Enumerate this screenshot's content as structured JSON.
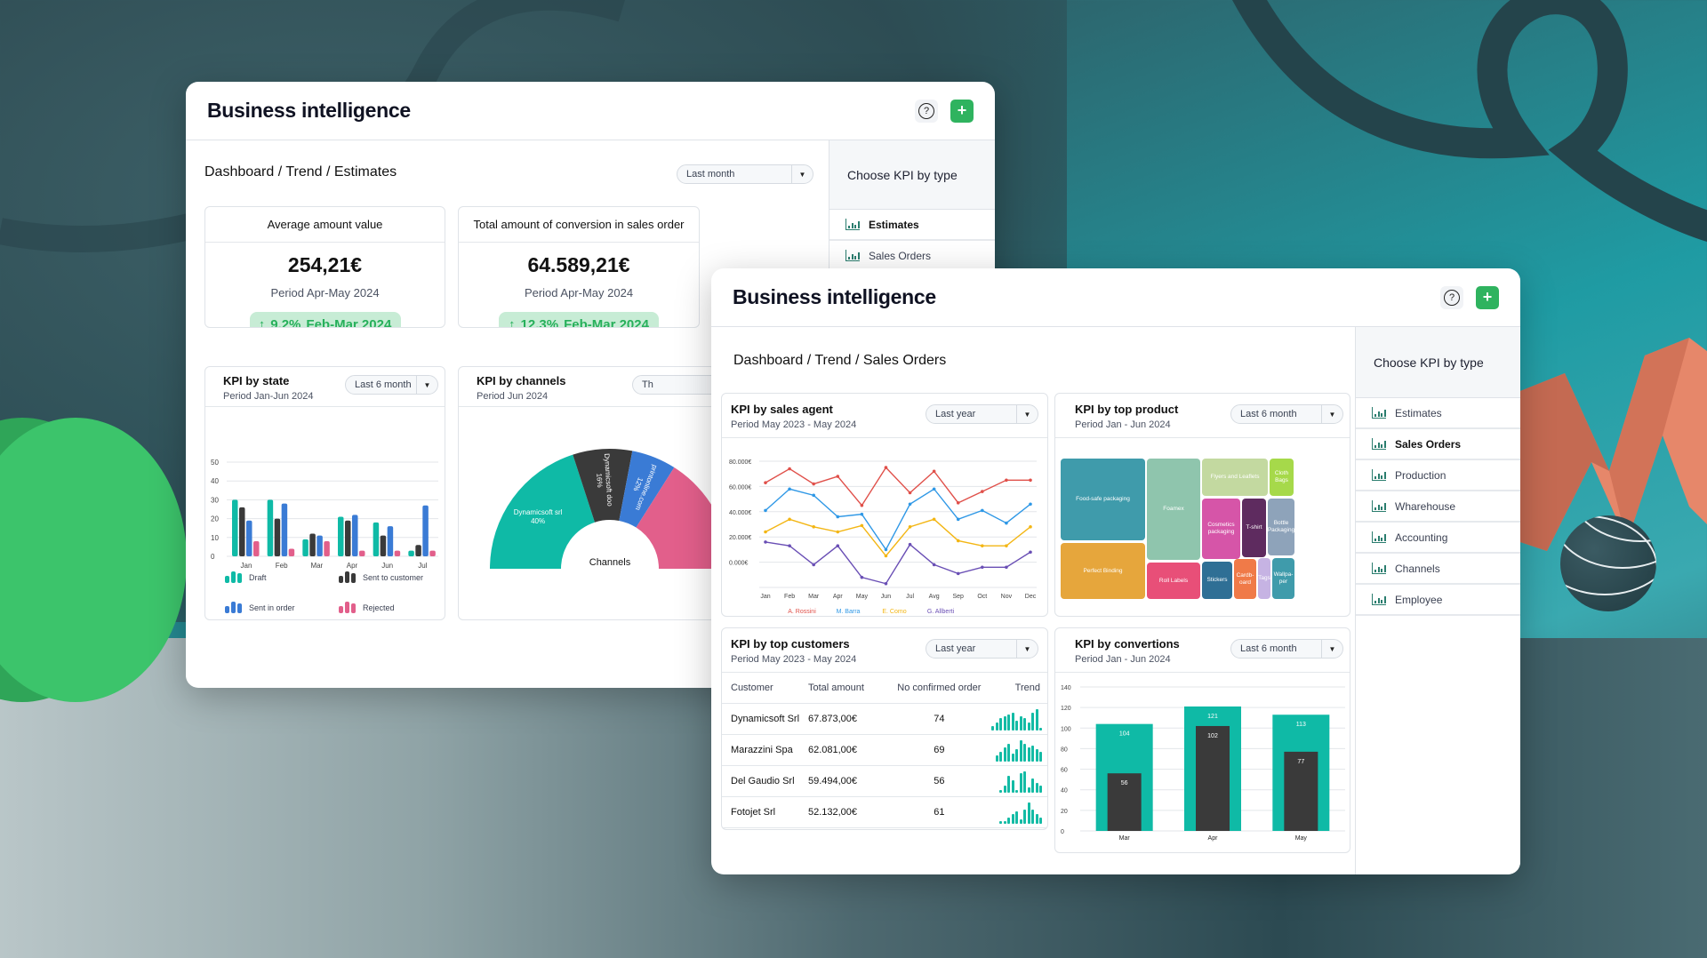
{
  "colors": {
    "teal": "#0fbaa6",
    "dark": "#3a3a3a",
    "blue": "#3a7bd5",
    "pink": "#e25f8b",
    "green_accent": "#2fb35f",
    "badge_bg": "#c7ecd5",
    "rossini": "#e0504a",
    "barra": "#2f98e6",
    "como": "#f3b614",
    "alberti": "#6a4fb5"
  },
  "window_estimates": {
    "title": "Business intelligence",
    "help_icon": "?",
    "add_icon": "+",
    "breadcrumb": "Dashboard / Trend / Estimates",
    "period_select": "Last month",
    "sidebar": {
      "title": "Choose KPI by type",
      "items": [
        {
          "label": "Estimates",
          "active": true
        },
        {
          "label": "Sales Orders",
          "active": false
        }
      ]
    },
    "kpi_cards": [
      {
        "title": "Average amount value",
        "value": "254,21€",
        "period": "Period Apr-May 2024",
        "delta": "9,2%",
        "delta_period": "Feb-Mar 2024",
        "arrow": "↑"
      },
      {
        "title": "Total amount of conversion in sales order",
        "value": "64.589,21€",
        "period": "Period Apr-May 2024",
        "delta": "12,3%",
        "delta_period": "Feb-Mar 2024",
        "arrow": "↑"
      }
    ],
    "kpi_by_state": {
      "title": "KPI by state",
      "subtitle": "Period Jan-Jun 2024",
      "select": "Last 6 month"
    },
    "kpi_by_channels": {
      "title": "KPI by channels",
      "subtitle": "Period Jun 2024",
      "select": "Th",
      "center_label": "Channels"
    }
  },
  "window_sales_orders": {
    "title": "Business intelligence",
    "help_icon": "?",
    "add_icon": "+",
    "breadcrumb": "Dashboard / Trend / Sales Orders",
    "sidebar": {
      "title": "Choose KPI by type",
      "items": [
        {
          "label": "Estimates",
          "active": false
        },
        {
          "label": "Sales Orders",
          "active": true
        },
        {
          "label": "Production",
          "active": false
        },
        {
          "label": "Wharehouse",
          "active": false
        },
        {
          "label": "Accounting",
          "active": false
        },
        {
          "label": "Channels",
          "active": false
        },
        {
          "label": "Employee",
          "active": false
        }
      ]
    },
    "kpi_by_sales_agent": {
      "title": "KPI by sales agent",
      "subtitle": "Period May 2023 - May 2024",
      "select": "Last year"
    },
    "kpi_by_top_product": {
      "title": "KPI by top product",
      "subtitle": "Period Jan - Jun 2024",
      "select": "Last 6 month"
    },
    "kpi_by_top_customers": {
      "title": "KPI by top customers",
      "subtitle": "Period May 2023 - May 2024",
      "select": "Last year",
      "columns": [
        "Customer",
        "Total amount",
        "No confirmed order",
        "Trend"
      ],
      "rows": [
        {
          "customer": "Dynamicsoft Srl",
          "total": "67.873,00€",
          "orders": "74",
          "trend": [
            2,
            4,
            6,
            7,
            8,
            9,
            5,
            7,
            6,
            4,
            9,
            11,
            1
          ]
        },
        {
          "customer": "Marazzini Spa",
          "total": "62.081,00€",
          "orders": "69",
          "trend": [
            3,
            5,
            7,
            9,
            4,
            6,
            11,
            9,
            7,
            8,
            6,
            5
          ]
        },
        {
          "customer": "Del Gaudio Srl",
          "total": "59.494,00€",
          "orders": "56",
          "trend": [
            1,
            3,
            7,
            5,
            1,
            8,
            9,
            2,
            6,
            4,
            3
          ]
        },
        {
          "customer": "Fotojet Srl",
          "total": "52.132,00€",
          "orders": "61",
          "trend": [
            1,
            1,
            3,
            5,
            6,
            2,
            7,
            11,
            7,
            5,
            3
          ]
        }
      ]
    },
    "kpi_by_convertions": {
      "title": "KPI by convertions",
      "subtitle": "Period Jan - Jun 2024",
      "select": "Last 6 month"
    }
  },
  "chart_data": [
    {
      "id": "kpi_by_state",
      "type": "bar",
      "title": "KPI by state",
      "categories": [
        "Jan",
        "Feb",
        "Mar",
        "Apr",
        "Jun",
        "Jul"
      ],
      "ylim": [
        0,
        50
      ],
      "yticks": [
        0,
        10,
        20,
        30,
        40,
        50
      ],
      "grid": true,
      "legend": "bottom",
      "series": [
        {
          "name": "Draft",
          "color": "#0fbaa6",
          "values": [
            30,
            30,
            9,
            21,
            18,
            3
          ]
        },
        {
          "name": "Sent to customer",
          "color": "#3a3a3a",
          "values": [
            26,
            20,
            12,
            19,
            11,
            6
          ]
        },
        {
          "name": "Sent in order",
          "color": "#3a7bd5",
          "values": [
            19,
            28,
            11,
            22,
            16,
            27
          ]
        },
        {
          "name": "Rejected",
          "color": "#e25f8b",
          "values": [
            8,
            4,
            8,
            3,
            3,
            3
          ]
        }
      ]
    },
    {
      "id": "kpi_by_channels",
      "type": "pie",
      "title": "KPI by channels",
      "center_label": "Channels",
      "slices": [
        {
          "label": "Dynamicsoft srl",
          "value": 40,
          "color": "#0fbaa6"
        },
        {
          "label": "Dynamicsoft doo",
          "value": 16,
          "color": "#3a3a3a"
        },
        {
          "label": "printonline.com",
          "value": 12,
          "color": "#3a7bd5"
        },
        {
          "label": "",
          "value": 32,
          "color": "#e25f8b"
        }
      ]
    },
    {
      "id": "kpi_by_sales_agent",
      "type": "line",
      "title": "KPI by sales agent",
      "categories": [
        "Jan",
        "Feb",
        "Mar",
        "Apr",
        "May",
        "Jun",
        "Jul",
        "Avg",
        "Sep",
        "Oct",
        "Nov",
        "Dec"
      ],
      "yticks": [
        "80.000€",
        "60.000€",
        "40.000€",
        "20.000€",
        "0.000€"
      ],
      "ylim": [
        -20000,
        80000
      ],
      "grid": true,
      "legend": "bottom",
      "series": [
        {
          "name": "A. Rossini",
          "color": "#e0504a",
          "values": [
            63000,
            74000,
            62000,
            68000,
            45000,
            75000,
            55000,
            72000,
            47000,
            56000,
            65000,
            65000
          ]
        },
        {
          "name": "M. Barra",
          "color": "#2f98e6",
          "values": [
            41000,
            58000,
            53000,
            36000,
            38000,
            10000,
            46000,
            58000,
            34000,
            41000,
            31000,
            46000
          ]
        },
        {
          "name": "E. Como",
          "color": "#f3b614",
          "values": [
            24000,
            34000,
            28000,
            24000,
            29000,
            5000,
            28000,
            34000,
            17000,
            13000,
            13000,
            28000
          ]
        },
        {
          "name": "G. Allberti",
          "color": "#6a4fb5",
          "values": [
            16000,
            13000,
            -2000,
            13000,
            -12000,
            -17000,
            14000,
            -2000,
            -9000,
            -4000,
            -4000,
            8000
          ]
        }
      ]
    },
    {
      "id": "kpi_by_top_product",
      "type": "heatmap",
      "subtype": "treemap",
      "title": "KPI by top product",
      "items": [
        {
          "label": "Food-safe packaging",
          "color": "#3f9bab"
        },
        {
          "label": "Perfect Binding",
          "color": "#e6a63c"
        },
        {
          "label": "Foamex",
          "color": "#8fc5ad"
        },
        {
          "label": "Roll Labels",
          "color": "#e84f78"
        },
        {
          "label": "Flyers and Leaflets",
          "color": "#c3d9a0"
        },
        {
          "label": "Cloth Bags",
          "color": "#a6d94a"
        },
        {
          "label": "Cosmetics packaging",
          "color": "#d655a8"
        },
        {
          "label": "T-shirt",
          "color": "#5e2b5f"
        },
        {
          "label": "Bottle Packaging",
          "color": "#8ea3ba"
        },
        {
          "label": "Stickers",
          "color": "#2f6f95"
        },
        {
          "label": "Cardb-oard",
          "color": "#f07a48"
        },
        {
          "label": "Tags",
          "color": "#c6b3e3"
        },
        {
          "label": "Wallpa-per",
          "color": "#3f9bab"
        }
      ]
    },
    {
      "id": "kpi_by_convertions",
      "type": "bar",
      "title": "KPI by convertions",
      "categories": [
        "Mar",
        "Apr",
        "May"
      ],
      "ylim": [
        0,
        140
      ],
      "yticks": [
        0,
        20,
        40,
        60,
        80,
        100,
        120,
        140
      ],
      "grid": true,
      "series": [
        {
          "name": "Total",
          "color": "#0fbaa6",
          "values": [
            104,
            121,
            113
          ]
        },
        {
          "name": "Converted",
          "color": "#3a3a3a",
          "values": [
            56,
            102,
            77
          ]
        }
      ]
    }
  ]
}
